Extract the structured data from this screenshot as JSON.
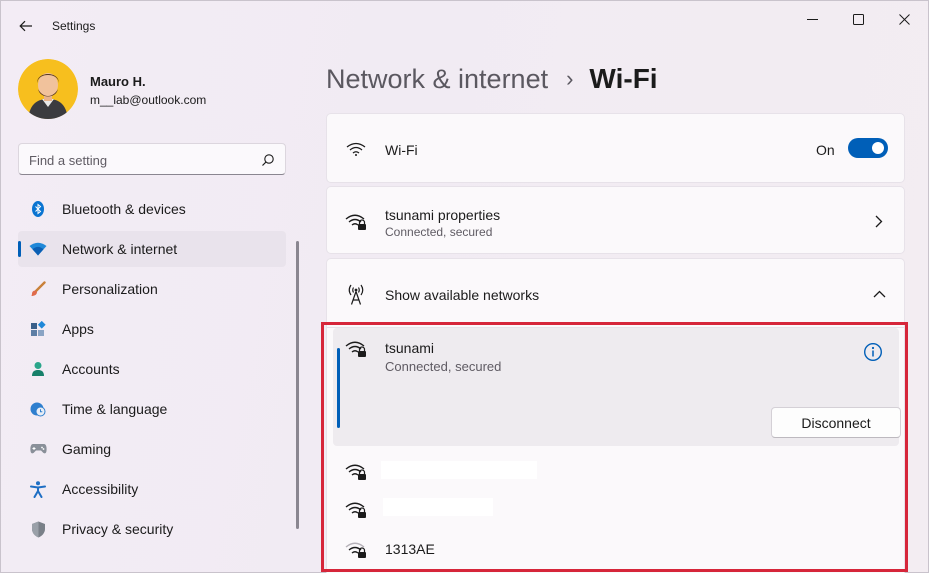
{
  "window": {
    "title": "Settings",
    "controls": [
      "minimize-icon",
      "maximize-icon",
      "close-icon"
    ]
  },
  "profile": {
    "name": "Mauro H.",
    "email": "m__lab@outlook.com"
  },
  "search": {
    "placeholder": "Find a setting"
  },
  "sidebar": {
    "items": [
      {
        "label": "Bluetooth & devices",
        "icon": "bluetooth-icon",
        "active": false
      },
      {
        "label": "Network & internet",
        "icon": "wifi-icon",
        "active": true
      },
      {
        "label": "Personalization",
        "icon": "brush-icon",
        "active": false
      },
      {
        "label": "Apps",
        "icon": "apps-icon",
        "active": false
      },
      {
        "label": "Accounts",
        "icon": "person-icon",
        "active": false
      },
      {
        "label": "Time & language",
        "icon": "clock-globe-icon",
        "active": false
      },
      {
        "label": "Gaming",
        "icon": "gamepad-icon",
        "active": false
      },
      {
        "label": "Accessibility",
        "icon": "accessibility-icon",
        "active": false
      },
      {
        "label": "Privacy & security",
        "icon": "shield-icon",
        "active": false
      }
    ]
  },
  "header": {
    "parent": "Network & internet",
    "separator": "›",
    "current": "Wi-Fi"
  },
  "wifi_card": {
    "title": "Wi-Fi",
    "toggle_label": "On",
    "toggle_on": true
  },
  "props_card": {
    "title": "tsunami properties",
    "subtitle": "Connected, secured"
  },
  "show_card": {
    "title": "Show available networks",
    "expanded": true
  },
  "networks": {
    "connected": {
      "name": "tsunami",
      "status": "Connected, secured",
      "button": "Disconnect"
    },
    "others": [
      {
        "name": "",
        "redacted": true
      },
      {
        "name": "",
        "redacted": true
      },
      {
        "name": "1313AE",
        "redacted": false
      }
    ]
  },
  "colors": {
    "accent": "#005fb8",
    "highlight": "#d6263a"
  }
}
